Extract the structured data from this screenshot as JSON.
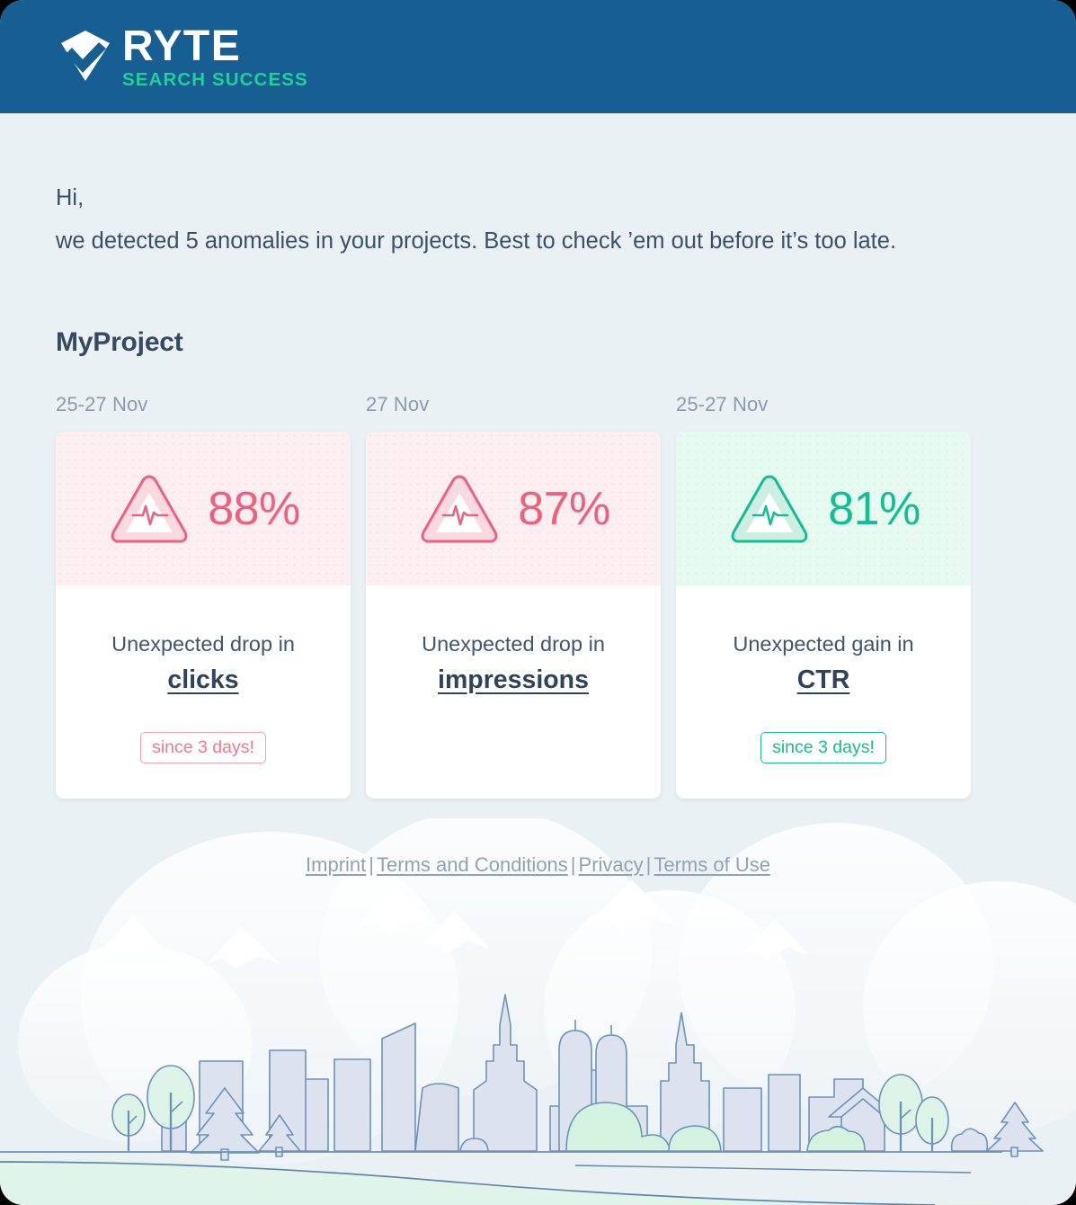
{
  "brand": {
    "logo_icon": "ryte-diamond-check-icon",
    "name": "RYTE",
    "tagline": "SEARCH SUCCESS",
    "header_color": "#175f93",
    "tagline_color": "#1fd09a"
  },
  "greeting": {
    "line1": "Hi,",
    "line2": "we detected 5 anomalies in your projects. Best to check ’em out before it’s too late."
  },
  "project": {
    "title": "MyProject"
  },
  "colors": {
    "negative": "#ee6080",
    "positive": "#11bf92",
    "negative_bg": "#fdeef1",
    "positive_bg": "#e6faf1",
    "page_bg": "#eaf1f5",
    "heading": "#344a63",
    "muted": "#8c9aac"
  },
  "cards": [
    {
      "date": "25-27 Nov",
      "percent": "88%",
      "icon": "warning-triangle-pulse-icon",
      "tone": "negative",
      "line1": "Unexpected drop in",
      "metric": "clicks",
      "badge": "since 3 days!",
      "has_badge": true
    },
    {
      "date": "27 Nov",
      "percent": "87%",
      "icon": "warning-triangle-pulse-icon",
      "tone": "negative",
      "line1": "Unexpected drop in",
      "metric": "impressions",
      "badge": "",
      "has_badge": false
    },
    {
      "date": "25-27 Nov",
      "percent": "81%",
      "icon": "warning-triangle-pulse-icon",
      "tone": "positive",
      "line1": "Unexpected gain in",
      "metric": "CTR",
      "badge": "since 3 days!",
      "has_badge": true
    }
  ],
  "footer": {
    "links": [
      {
        "label": "Imprint"
      },
      {
        "label": "Terms and Conditions"
      },
      {
        "label": "Privacy"
      },
      {
        "label": "Terms of Use"
      }
    ],
    "separator": "|"
  },
  "illustration": {
    "name": "city-skyline-landscape-illustration",
    "elements": [
      "clouds",
      "mountains",
      "snow-peaks",
      "city-skyline",
      "church-towers",
      "trees",
      "pine-trees",
      "bushes",
      "house",
      "meadow"
    ]
  }
}
